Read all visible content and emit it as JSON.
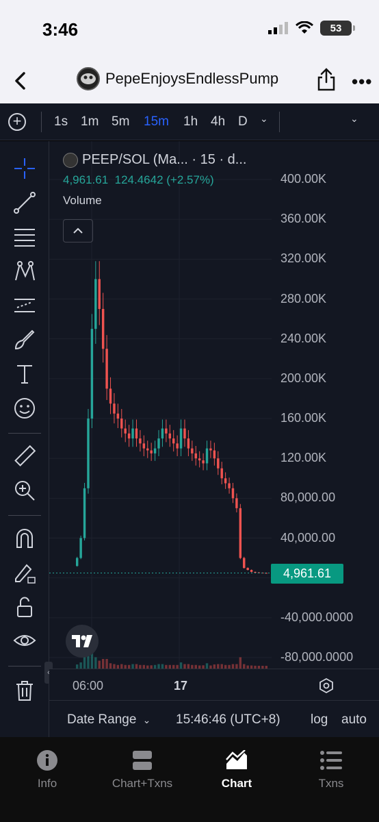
{
  "status": {
    "time": "3:46",
    "battery": "53"
  },
  "nav": {
    "title": "PepeEnjoysEndlessPump"
  },
  "toolbar": {
    "timeframes": [
      "1s",
      "1m",
      "5m",
      "15m",
      "1h",
      "4h",
      "D"
    ],
    "active_timeframe": "15m"
  },
  "legend": {
    "symbol": "PEEP/SOL (Ma... · 15 · d...",
    "price": "4,961.61",
    "change": "124.4642 (+2.57%)",
    "volume_label": "Volume"
  },
  "price_axis": {
    "labels": [
      "400.00K",
      "360.00K",
      "320.00K",
      "280.00K",
      "240.00K",
      "200.00K",
      "160.00K",
      "120.00K",
      "80,000.00",
      "40,000.00",
      "-40,000.0000",
      "-80,000.0000"
    ],
    "last_price": "4,961.61"
  },
  "time_axis": {
    "labels": [
      "06:00",
      "17"
    ]
  },
  "bottom_bar": {
    "date_range": "Date Range",
    "clock": "15:46:46 (UTC+8)",
    "log": "log",
    "auto": "auto"
  },
  "tabs": [
    {
      "label": "Info",
      "icon": "info-icon"
    },
    {
      "label": "Chart+Txns",
      "icon": "split-view-icon"
    },
    {
      "label": "Chart",
      "icon": "chart-icon"
    },
    {
      "label": "Txns",
      "icon": "list-icon"
    }
  ],
  "active_tab": "Chart",
  "colors": {
    "up": "#26a69a",
    "down": "#ef5350",
    "accent": "#2962ff",
    "last_price_bg": "#089981"
  },
  "chart_data": {
    "type": "candlestick",
    "ylim": [
      -80000,
      400000
    ],
    "close": [
      20000,
      40000,
      90000,
      160000,
      250000,
      300000,
      270000,
      230000,
      190000,
      175000,
      165000,
      160000,
      150000,
      145000,
      140000,
      150000,
      140000,
      135000,
      130000,
      128000,
      125000,
      130000,
      140000,
      150000,
      145000,
      140000,
      135000,
      130000,
      150000,
      140000,
      130000,
      125000,
      120000,
      118000,
      115000,
      130000,
      128000,
      120000,
      110000,
      100000,
      95000,
      90000,
      80000,
      70000,
      20000,
      10000,
      8000,
      6000,
      5500,
      5200,
      5000,
      4961.61
    ]
  }
}
